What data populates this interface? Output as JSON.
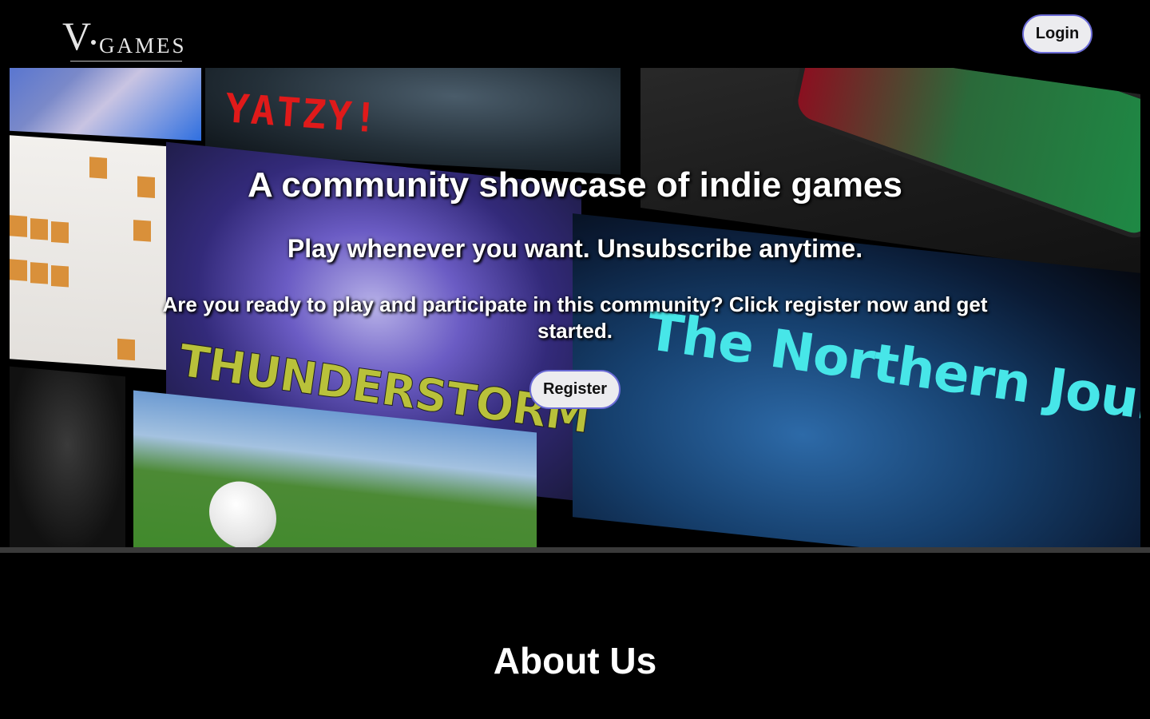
{
  "header": {
    "logo_v": "V",
    "logo_games": "GAMES",
    "login_label": "Login"
  },
  "hero": {
    "title": "A community showcase of indie games",
    "subtitle": "Play whenever you want. Unsubscribe anytime.",
    "text": "Are you ready to play and participate in this community? Click register now and get started.",
    "register_label": "Register",
    "tiles": {
      "yatzy": "YATZY!",
      "thunderstorm": "THUNDERSTORM",
      "northern_journey": "The Northern Journey"
    }
  },
  "about": {
    "heading": "About Us"
  }
}
